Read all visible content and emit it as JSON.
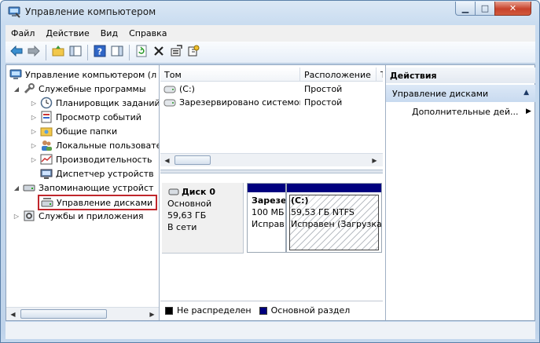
{
  "window": {
    "title": "Управление компьютером"
  },
  "menu": [
    "Файл",
    "Действие",
    "Вид",
    "Справка"
  ],
  "tree": {
    "root": "Управление компьютером (л",
    "system_tools": "Служебные программы",
    "system_children": [
      "Планировщик заданий",
      "Просмотр событий",
      "Общие папки",
      "Локальные пользовате",
      "Производительность",
      "Диспетчер устройств"
    ],
    "storage": "Запоминающие устройст",
    "disk_management": "Управление дисками",
    "services": "Службы и приложения"
  },
  "volumes": {
    "headers": [
      "Том",
      "Расположение",
      "Т"
    ],
    "rows": [
      {
        "name": "(C:)",
        "location": "Простой",
        "type": ""
      },
      {
        "name": "Зарезервировано системой",
        "location": "Простой",
        "type": ""
      }
    ]
  },
  "disk": {
    "name": "Диск 0",
    "type": "Основной",
    "size": "59,63 ГБ",
    "status": "В сети",
    "partitions": [
      {
        "line1": "Зарезе",
        "line2": "100 МБ",
        "line3": "Исправ"
      },
      {
        "line1": "(C:)",
        "line2": "59,53 ГБ NTFS",
        "line3": "Исправен (Загрузка,"
      }
    ]
  },
  "legend": [
    {
      "label": "Не распределен",
      "color": "#000000"
    },
    {
      "label": "Основной раздел",
      "color": "#00007f"
    }
  ],
  "actions": {
    "header": "Действия",
    "section": "Управление дисками",
    "more": "Дополнительные дей..."
  },
  "colors": {
    "selection_outline": "#c0262c",
    "primary_partition": "#00007f"
  }
}
